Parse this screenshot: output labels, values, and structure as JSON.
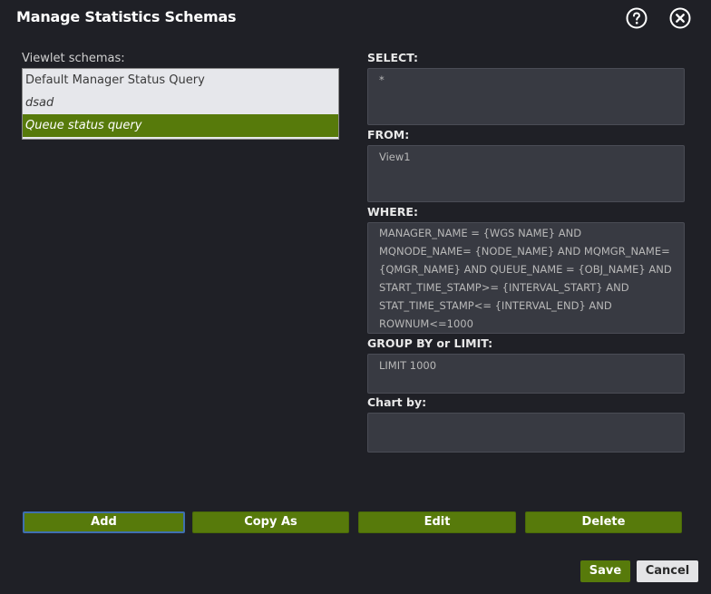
{
  "dialog": {
    "title": "Manage Statistics Schemas",
    "help_icon": "help-circle-icon",
    "close_icon": "close-circle-icon"
  },
  "left": {
    "label": "Viewlet schemas:",
    "schemas": [
      {
        "name": "Default Manager Status Query",
        "italic": false,
        "selected": false
      },
      {
        "name": "dsad",
        "italic": true,
        "selected": false
      },
      {
        "name": "Queue status query",
        "italic": true,
        "selected": true
      }
    ]
  },
  "fields": {
    "select": {
      "label": "SELECT:",
      "value": "*"
    },
    "from": {
      "label": "FROM:",
      "value": "View1"
    },
    "where": {
      "label": "WHERE:",
      "value": "MANAGER_NAME = {WGS NAME} AND MQNODE_NAME= {NODE_NAME} AND MQMGR_NAME={QMGR_NAME} AND QUEUE_NAME = {OBJ_NAME} AND START_TIME_STAMP>= {INTERVAL_START} AND STAT_TIME_STAMP<= {INTERVAL_END} AND ROWNUM<=1000"
    },
    "group_by": {
      "label": "GROUP BY or LIMIT:",
      "value": "LIMIT 1000"
    },
    "chart_by": {
      "label": "Chart by:",
      "value": ""
    }
  },
  "actions": {
    "add": "Add",
    "copy_as": "Copy As",
    "edit": "Edit",
    "delete": "Delete"
  },
  "footer": {
    "save": "Save",
    "cancel": "Cancel"
  },
  "colors": {
    "background": "#1f2026",
    "accent_green": "#577a0b",
    "focus_blue": "#3f6fb0",
    "field_bg": "#383a42"
  }
}
